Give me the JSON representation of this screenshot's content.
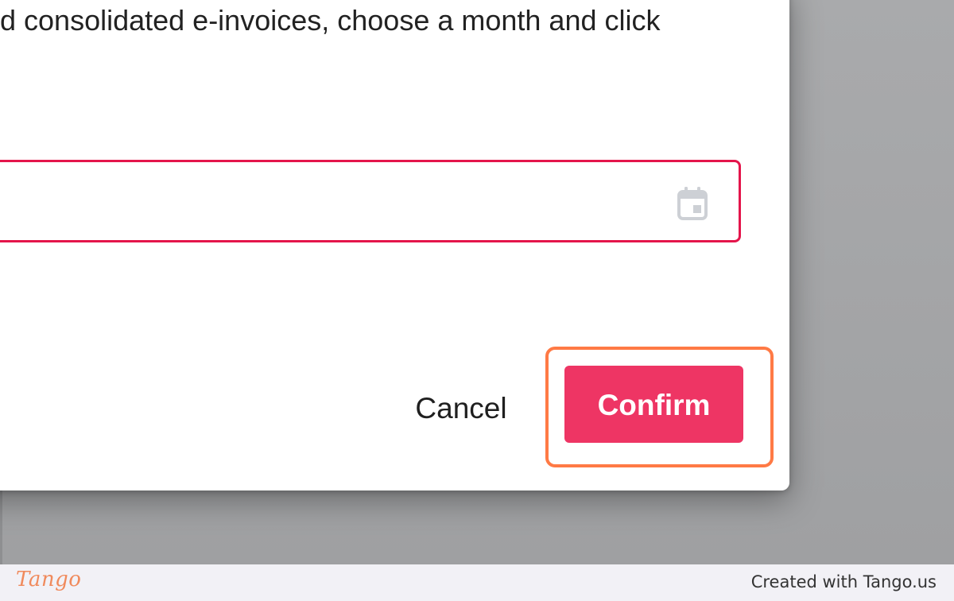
{
  "dialog": {
    "description": "d consolidated e-invoices, choose a month and click",
    "month_input_value": "",
    "calendar_icon": "calendar-icon",
    "cancel_label": "Cancel",
    "confirm_label": "Confirm"
  },
  "footer": {
    "logo_text": "Tango",
    "credit_text": "Created with Tango.us"
  },
  "colors": {
    "confirm_bg": "#ee3564",
    "input_border": "#e4154b",
    "highlight": "#ff7a45",
    "backdrop": "#a5a6a8",
    "footer_bg": "#f2f1f6",
    "logo": "#f08a5c"
  }
}
